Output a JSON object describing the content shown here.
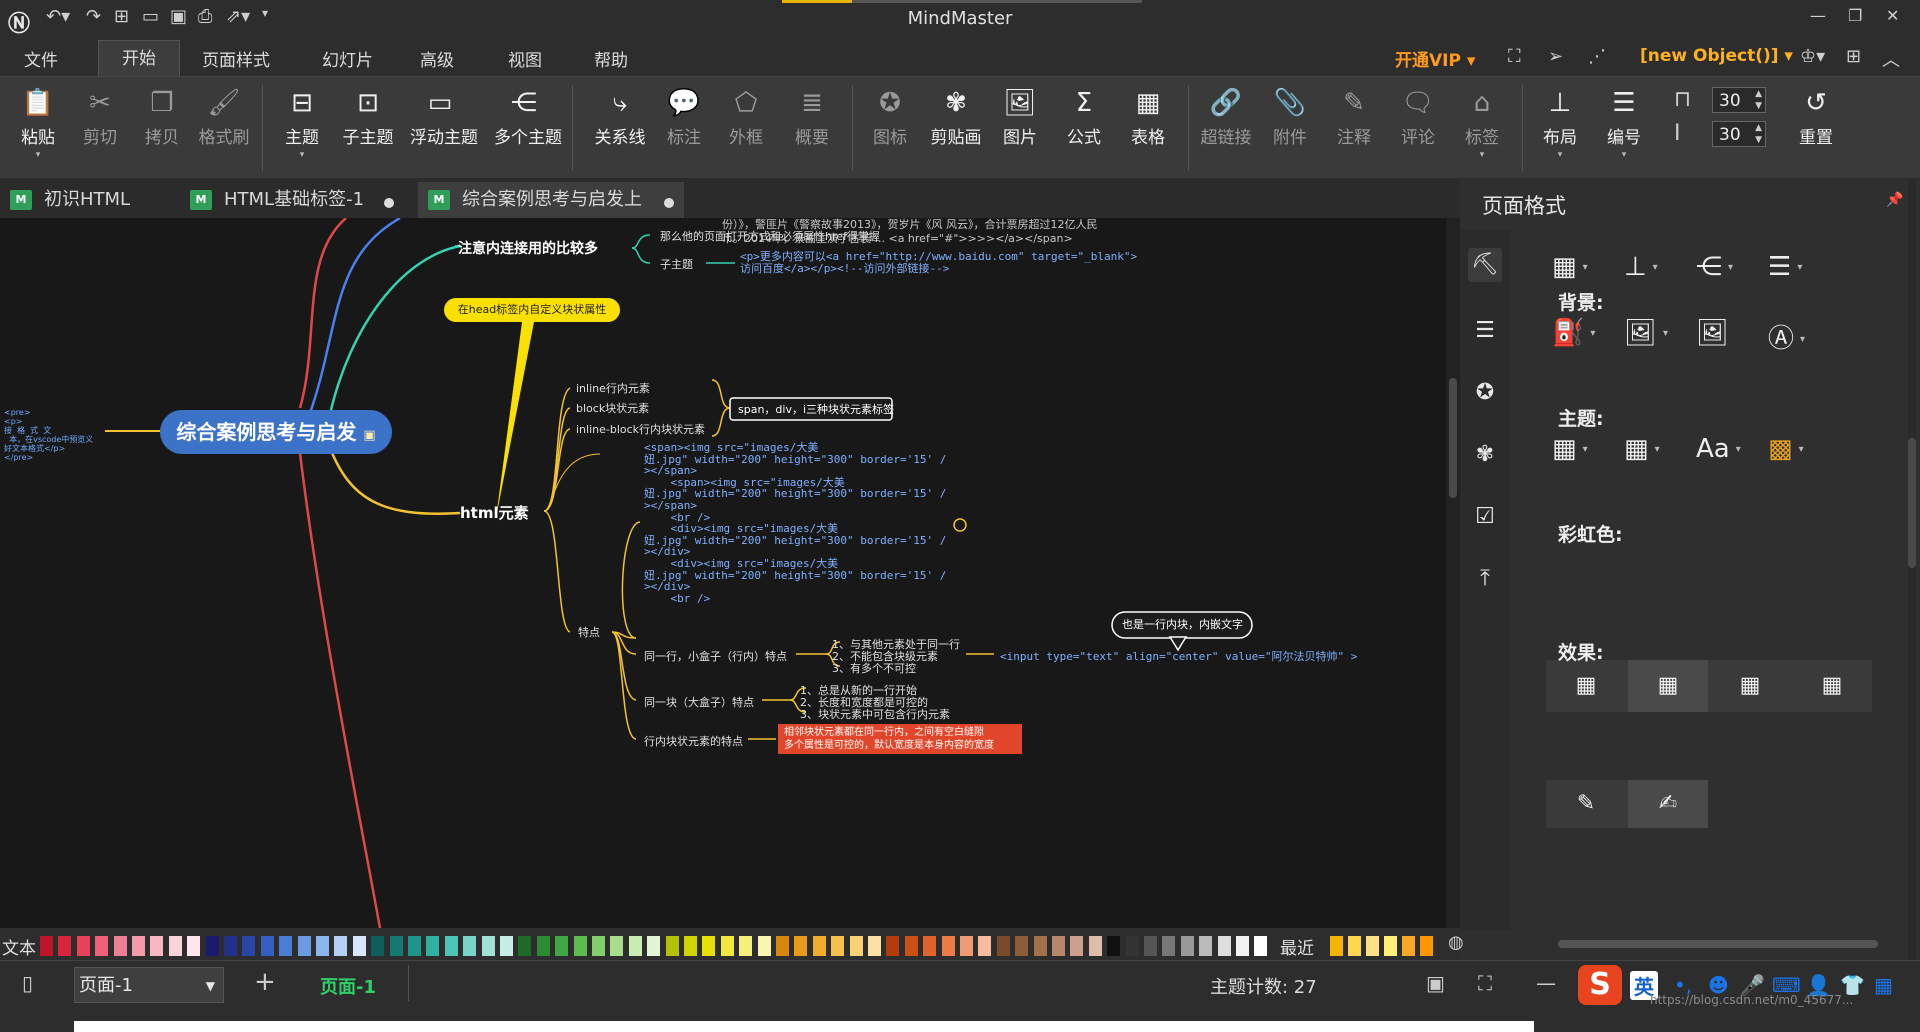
{
  "app": {
    "title": "MindMaster"
  },
  "menu": {
    "file": "文件",
    "start": "开始",
    "page_style": "页面样式",
    "slides": "幻灯片",
    "advanced": "高级",
    "view": "视图",
    "help": "帮助",
    "vip": "开通VIP ▾",
    "new_object": "[new Object()] ▾"
  },
  "ribbon": {
    "paste": "粘贴",
    "cut": "剪切",
    "copy": "拷贝",
    "format_brush": "格式刷",
    "topic": "主题",
    "subtopic": "子主题",
    "floating_topic": "浮动主题",
    "multi_topic": "多个主题",
    "relation": "关系线",
    "callout": "标注",
    "boundary": "外框",
    "summary": "概要",
    "icon": "图标",
    "clipart": "剪贴画",
    "picture": "图片",
    "formula": "公式",
    "table": "表格",
    "hyperlink": "超链接",
    "attachment": "附件",
    "note": "注释",
    "comment": "评论",
    "tag": "标签",
    "layout": "布局",
    "numbering": "编号",
    "spacing_h": "30",
    "spacing_v": "30",
    "reset": "重置"
  },
  "tabs": [
    {
      "label": "初识HTML"
    },
    {
      "label": "HTML基础标签-1"
    },
    {
      "label": "综合案例思考与启发上"
    }
  ],
  "mindmap": {
    "central": "综合案例思考与启发",
    "top_text_1": "份）》，警匪片《警察故事2013》，贺岁片《风 风云》，合计票房超过12亿人民",
    "top_text_2": "币。2014年，景甜主演了古装 ... <a href=\"#\">>>></a></span>",
    "branch_link": "注意内连接用的比较多",
    "link_child_1": "那么他的页面打开方式和必须属性href得掌握",
    "link_child_2": "子主题",
    "link_code_1": "<p>更多内容可以<a href=\"http://www.baidu.com\"  target=\"_blank\">",
    "link_code_2": "访问百度</a></p><!--访问外部链接-->",
    "callout_head": "在head标签内自定义块状属性",
    "left_code": "<pre>\n<p>\n接  格  式  文\n  本，在vscode中预览义\n好文本格式</p>\n</pre>",
    "branch_html": "html元素",
    "inline": "inline行内元素",
    "block": "block块状元素",
    "inline_block": "inline-block行内块状元素",
    "three_types": "span，div，i三种块状元素标签",
    "code_lines": [
      "<span><img src=\"images/大美",
      "妞.jpg\" width=\"200\" height=\"300\" border='15' /",
      "></span>",
      "    <span><img src=\"images/大美",
      "妞.jpg\" width=\"200\" height=\"300\" border='15' /",
      "></span>",
      "    <br />",
      "    <div><img src=\"images/大美",
      "妞.jpg\" width=\"200\" height=\"300\" border='15' /",
      "></div>",
      "    <div><img src=\"images/大美",
      "妞.jpg\" width=\"200\" height=\"300\" border='15' /",
      "></div>",
      "    <br />"
    ],
    "features": "特点",
    "inline_feat": "同一行，小盒子（行内）特点",
    "inline_feat_items": [
      "1、与其他元素处于同一行",
      "2、不能包含块级元素",
      "3、有多个不可控"
    ],
    "inline_callout": "也是一行内块，内嵌文字",
    "inline_input": "<input type=\"text\" align=\"center\" value=\"阿尔法贝特帅\" >",
    "block_feat": "同一块（大盒子）特点",
    "block_feat_items": [
      "1、总是从新的一行开始",
      "2、长度和宽度都是可控的",
      "3、块状元素中可包含行内元素"
    ],
    "ib_feat": "行内块状元素的特点",
    "ib_note": "相邻块状元素都在同一行内，之间有空白缝隙\n多个属性是可控的，默认宽度是本身内容的宽度"
  },
  "panel": {
    "title": "页面格式",
    "background": "背景:",
    "theme": "主题:",
    "rainbow": "彩虹色:",
    "effect": "效果:"
  },
  "palette": {
    "label": "文本",
    "recent": "最近",
    "colors": [
      "#c0142a",
      "#d8253c",
      "#e8415a",
      "#f0607a",
      "#ee7f94",
      "#f59aab",
      "#f7b7c3",
      "#fad2da",
      "#fde7ec",
      "#1a1a6e",
      "#20308c",
      "#2a45a8",
      "#3560c2",
      "#4a7ed8",
      "#6a9ce6",
      "#8db6ee",
      "#b4d0f4",
      "#d8e6fa",
      "#0d5e5c",
      "#127a72",
      "#1c958a",
      "#2eb0a2",
      "#4cc4b6",
      "#76d4c8",
      "#a0e2d8",
      "#c6eee8",
      "#1f6b26",
      "#2c8a33",
      "#3ea845",
      "#5cbd4e",
      "#80cf6a",
      "#a6de8c",
      "#c8ecb2",
      "#e2f6d6",
      "#b4c100",
      "#d0d400",
      "#e8e000",
      "#f2ea3a",
      "#f6f07a",
      "#faf6b0",
      "#d8860c",
      "#e89a18",
      "#f2ae2a",
      "#f6c04a",
      "#f9d276",
      "#fbe2a4",
      "#b43c0c",
      "#cc4f16",
      "#e0642a",
      "#ec7c48",
      "#f29a70",
      "#f7bc9e",
      "#7a4a2a",
      "#8e5c38",
      "#a4704a",
      "#b8866a",
      "#cca08a",
      "#e0bcaa",
      "#111111",
      "#333333",
      "#555555",
      "#777777",
      "#999999",
      "#bbbbbb",
      "#dddddd",
      "#f2f2f2",
      "#ffffff"
    ],
    "recent_colors": [
      "#f4b400",
      "#ffd54f",
      "#ffe082",
      "#fff176",
      "#f9a825",
      "#ff9800"
    ]
  },
  "status": {
    "page": "页面-1",
    "page_tab": "页面-1",
    "topic_count": "主题计数:  27",
    "ime": "英",
    "watermark": "https://blog.csdn.net/m0_45677..."
  },
  "colors": {
    "central": "#3c73c8",
    "branch_yellow": "#f2c230",
    "branch_teal": "#36d1b0",
    "branch_red": "#e04848",
    "branch_blue": "#4a7ff0",
    "callout_yellow": "#f9e000",
    "note_red": "#e2462a"
  }
}
